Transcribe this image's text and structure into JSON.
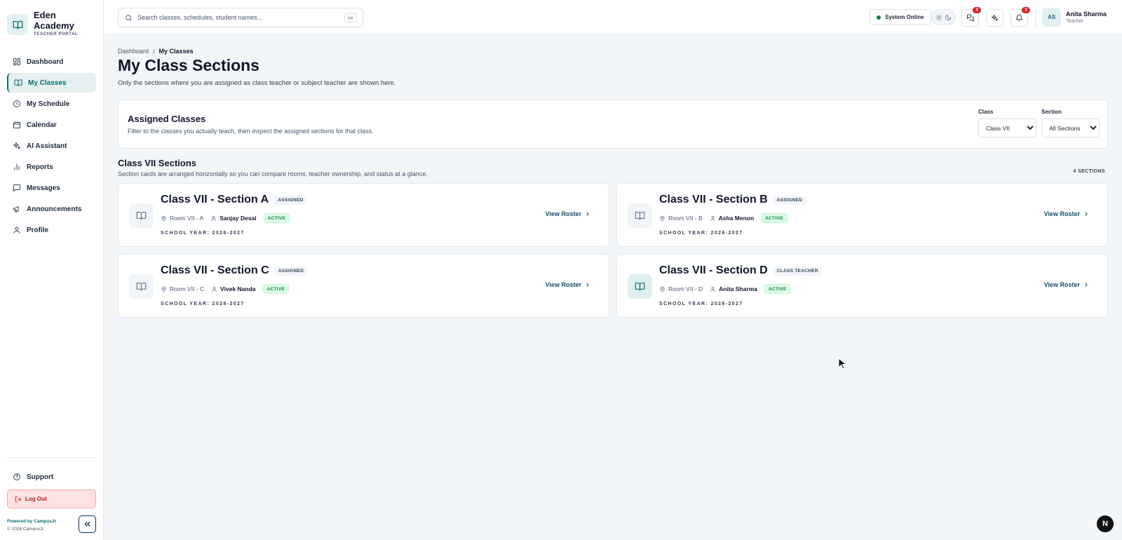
{
  "brand": {
    "name": "Eden Academy",
    "subtitle": "TEACHER PORTAL"
  },
  "sidebar": {
    "items": [
      {
        "label": "Dashboard",
        "icon": "grid-icon",
        "active": false
      },
      {
        "label": "My Classes",
        "icon": "book-open-icon",
        "active": true
      },
      {
        "label": "My Schedule",
        "icon": "clock-icon",
        "active": false
      },
      {
        "label": "Calendar",
        "icon": "calendar-icon",
        "active": false
      },
      {
        "label": "AI Assistant",
        "icon": "sparkles-icon",
        "active": false
      },
      {
        "label": "Reports",
        "icon": "bar-chart-icon",
        "active": false
      },
      {
        "label": "Messages",
        "icon": "message-square-icon",
        "active": false
      },
      {
        "label": "Announcements",
        "icon": "megaphone-icon",
        "active": false
      },
      {
        "label": "Profile",
        "icon": "user-icon",
        "active": false
      }
    ],
    "support_label": "Support",
    "logout_label": "Log Out",
    "powered_by": "Powered by CampusJr",
    "copyright": "© 2026 CampusJr"
  },
  "topbar": {
    "search_placeholder": "Search classes, schedules, student names...",
    "search_shortcut": "⌘K",
    "status_label": "System Online",
    "messages_badge": "3",
    "notifications_badge": "3",
    "user": {
      "initials": "AS",
      "name": "Anita Sharma",
      "role": "Teacher"
    }
  },
  "page": {
    "breadcrumb": [
      "Dashboard",
      "My Classes"
    ],
    "title": "My Class Sections",
    "description": "Only the sections where you are assigned as class teacher or subject teacher are shown here."
  },
  "filters": {
    "title": "Assigned Classes",
    "description": "Filter to the classes you actually teach, then inspect the assigned sections for that class.",
    "class_label": "Class",
    "class_value": "Class VII",
    "section_label": "Section",
    "section_value": "All Sections"
  },
  "sections": {
    "title": "Class VII Sections",
    "description": "Section cards are arranged horizontally so you can compare rooms, teacher ownership, and status at a glance.",
    "count_label": "4 SECTIONS",
    "cards": [
      {
        "title": "Class VII - Section A",
        "role": "ASSIGNED",
        "room": "Room VII - A",
        "teacher": "Sanjay Desai",
        "status": "ACTIVE",
        "year": "SCHOOL YEAR: 2026-2027",
        "link": "View Roster",
        "highlight": false
      },
      {
        "title": "Class VII - Section B",
        "role": "ASSIGNED",
        "room": "Room VII - B",
        "teacher": "Asha Menon",
        "status": "ACTIVE",
        "year": "SCHOOL YEAR: 2026-2027",
        "link": "View Roster",
        "highlight": false
      },
      {
        "title": "Class VII - Section C",
        "role": "ASSIGNED",
        "room": "Room VII - C",
        "teacher": "Vivek Nanda",
        "status": "ACTIVE",
        "year": "SCHOOL YEAR: 2026-2027",
        "link": "View Roster",
        "highlight": false
      },
      {
        "title": "Class VII - Section D",
        "role": "CLASS TEACHER",
        "room": "Room VII - D",
        "teacher": "Anita Sharma",
        "status": "ACTIVE",
        "year": "SCHOOL YEAR: 2026-2027",
        "link": "View Roster",
        "highlight": true
      }
    ]
  },
  "colors": {
    "accent": "#0f6b72",
    "active_status": "#15803d",
    "danger": "#b91c1c"
  },
  "dev_badge": "N"
}
